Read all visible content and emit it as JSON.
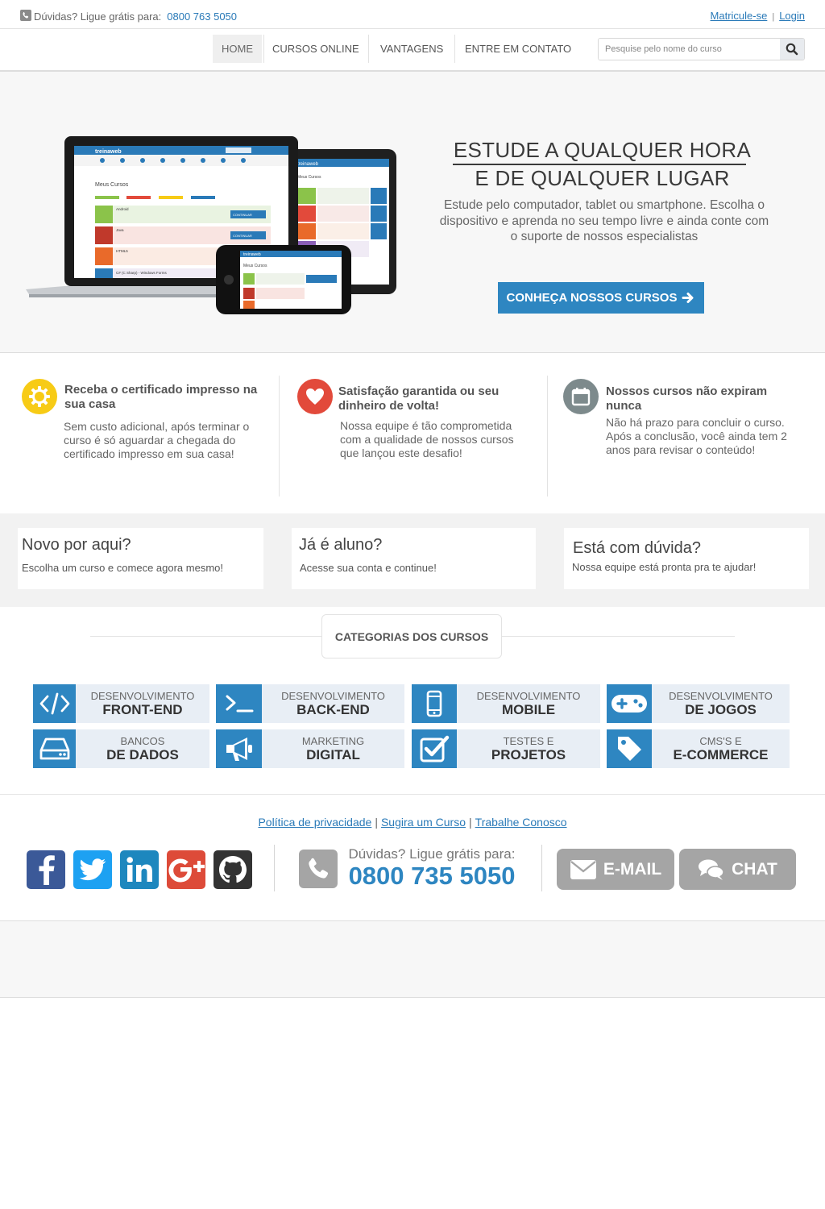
{
  "topbar": {
    "phone_prefix": "Dúvidas? Ligue grátis para:",
    "phone_number": "0800 763 5050",
    "matricule_label": "Matricule-se",
    "separator": "|",
    "login_label": "Login"
  },
  "nav": {
    "items": [
      "HOME",
      "CURSOS ONLINE",
      "VANTAGENS",
      "ENTRE EM CONTATO"
    ],
    "active": "HOME",
    "search_placeholder": "Pesquise pelo nome do curso"
  },
  "hero": {
    "title_line1": "ESTUDE A QUALQUER HORA",
    "title_line2": "E DE QUALQUER LUGAR",
    "description": "Estude pelo computador, tablet ou smartphone. Escolha o dispositivo e aprenda no seu tempo livre e ainda conte com o suporte de nossos especialistas",
    "cta_label": "CONHEÇA NOSSOS CURSOS",
    "screen": {
      "brand": "treinaweb",
      "heading": "Meus Cursos",
      "courses": [
        "Android",
        "Java",
        "HTML5",
        "C# (C Sharp) - Windows Forms"
      ],
      "continue_label": "CONTINUAR"
    }
  },
  "features": [
    {
      "title": "Receba o certificado impresso na sua casa",
      "text": "Sem custo adicional, após terminar o curso é só aguardar a chegada do certificado impresso em sua casa!",
      "icon": "certificate-seal-icon",
      "color": "#f7cb16"
    },
    {
      "title": "Satisfação garantida ou seu dinheiro de volta!",
      "text": "Nossa equipe é tão comprometida com a qualidade de nossos cursos que lançou este desafio!",
      "icon": "heart-icon",
      "color": "#e24a3b"
    },
    {
      "title": "Nossos cursos não expiram nunca",
      "text": "Não há prazo para concluir o curso. Após a conclusão, você ainda tem 2 anos para revisar o conteúdo!",
      "icon": "calendar-icon",
      "color": "#7d8a8c"
    }
  ],
  "info_boxes": [
    {
      "title": "Novo por aqui?",
      "text": "Escolha um curso e comece agora mesmo!"
    },
    {
      "title": "Já é aluno?",
      "text": "Acesse sua conta e continue!"
    },
    {
      "title": "Está com dúvida?",
      "text": "Nossa equipe está pronta pra te ajudar!"
    }
  ],
  "categories": {
    "heading": "CATEGORIAS DOS CURSOS",
    "items": [
      {
        "top": "DESENVOLVIMENTO",
        "bottom": "FRONT-END",
        "icon": "code-icon"
      },
      {
        "top": "DESENVOLVIMENTO",
        "bottom": "BACK-END",
        "icon": "terminal-icon"
      },
      {
        "top": "DESENVOLVIMENTO",
        "bottom": "MOBILE",
        "icon": "mobile-icon"
      },
      {
        "top": "DESENVOLVIMENTO",
        "bottom": "DE JOGOS",
        "icon": "gamepad-icon"
      },
      {
        "top": "BANCOS",
        "bottom": "DE DADOS",
        "icon": "hard-drive-icon"
      },
      {
        "top": "MARKETING",
        "bottom": "DIGITAL",
        "icon": "megaphone-icon"
      },
      {
        "top": "TESTES E",
        "bottom": "PROJETOS",
        "icon": "checkbox-icon"
      },
      {
        "top": "CMS'S E",
        "bottom": "E-COMMERCE",
        "icon": "tag-icon"
      }
    ]
  },
  "footer": {
    "links": [
      "Política de privacidade",
      "Sugira um Curso",
      "Trabalhe Conosco"
    ],
    "link_separator": "|",
    "social": [
      {
        "icon": "facebook-icon",
        "color": "#3b5998"
      },
      {
        "icon": "twitter-icon",
        "color": "#1da1f2"
      },
      {
        "icon": "linkedin-icon",
        "color": "#1d87be"
      },
      {
        "icon": "google-plus-icon",
        "color": "#dd4b39"
      },
      {
        "icon": "github-icon",
        "color": "#333333"
      }
    ],
    "phone_prefix": "Dúvidas? Ligue grátis para:",
    "phone_number": "0800 735 5050",
    "email_label": "E-MAIL",
    "chat_label": "CHAT"
  }
}
